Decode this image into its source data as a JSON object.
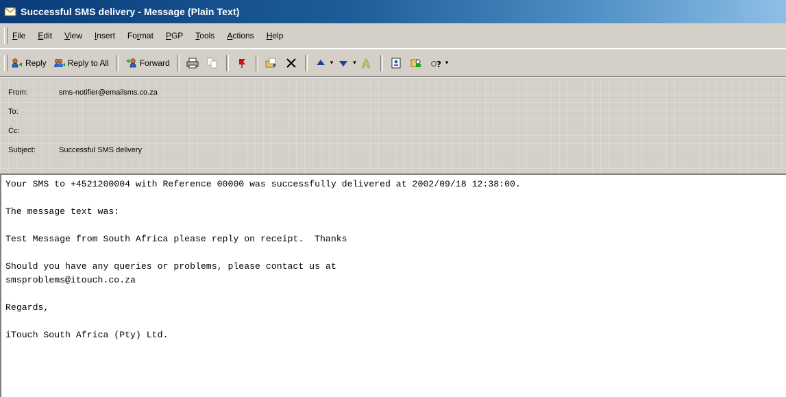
{
  "window": {
    "title": "Successful SMS delivery - Message (Plain Text)"
  },
  "menu": {
    "items": [
      {
        "label_ul": "F",
        "label_rest": "ile"
      },
      {
        "label_ul": "E",
        "label_rest": "dit"
      },
      {
        "label_ul": "V",
        "label_rest": "iew"
      },
      {
        "label_ul": "I",
        "label_rest": "nsert"
      },
      {
        "label_pre": "Fo",
        "label_ul": "r",
        "label_rest": "mat"
      },
      {
        "label_ul": "P",
        "label_rest": "GP"
      },
      {
        "label_ul": "T",
        "label_rest": "ools"
      },
      {
        "label_ul": "A",
        "label_rest": "ctions"
      },
      {
        "label_ul": "H",
        "label_rest": "elp"
      }
    ]
  },
  "toolbar": {
    "reply_label": "Reply",
    "reply_all_label": "Reply to All",
    "forward_label": "Forward"
  },
  "header": {
    "from_label": "From:",
    "from_value": "sms-notifier@emailsms.co.za",
    "to_label": "To:",
    "to_value": "",
    "cc_label": "Cc:",
    "cc_value": "",
    "subject_label": "Subject:",
    "subject_value": "Successful SMS delivery"
  },
  "body": {
    "lines": [
      "Your SMS to +4521200004 with Reference 00000 was successfully delivered at 2002/09/18 12:38:00.",
      "",
      "The message text was:",
      "",
      "Test Message from South Africa please reply on receipt.  Thanks",
      "",
      "Should you have any queries or problems, please contact us at",
      "smsproblems@itouch.co.za",
      "",
      "Regards,",
      "",
      "iTouch South Africa (Pty) Ltd."
    ]
  },
  "colors": {
    "titlebar_start": "#0a3b7a",
    "titlebar_end": "#8fbfe6",
    "chrome": "#d4d0c8"
  }
}
